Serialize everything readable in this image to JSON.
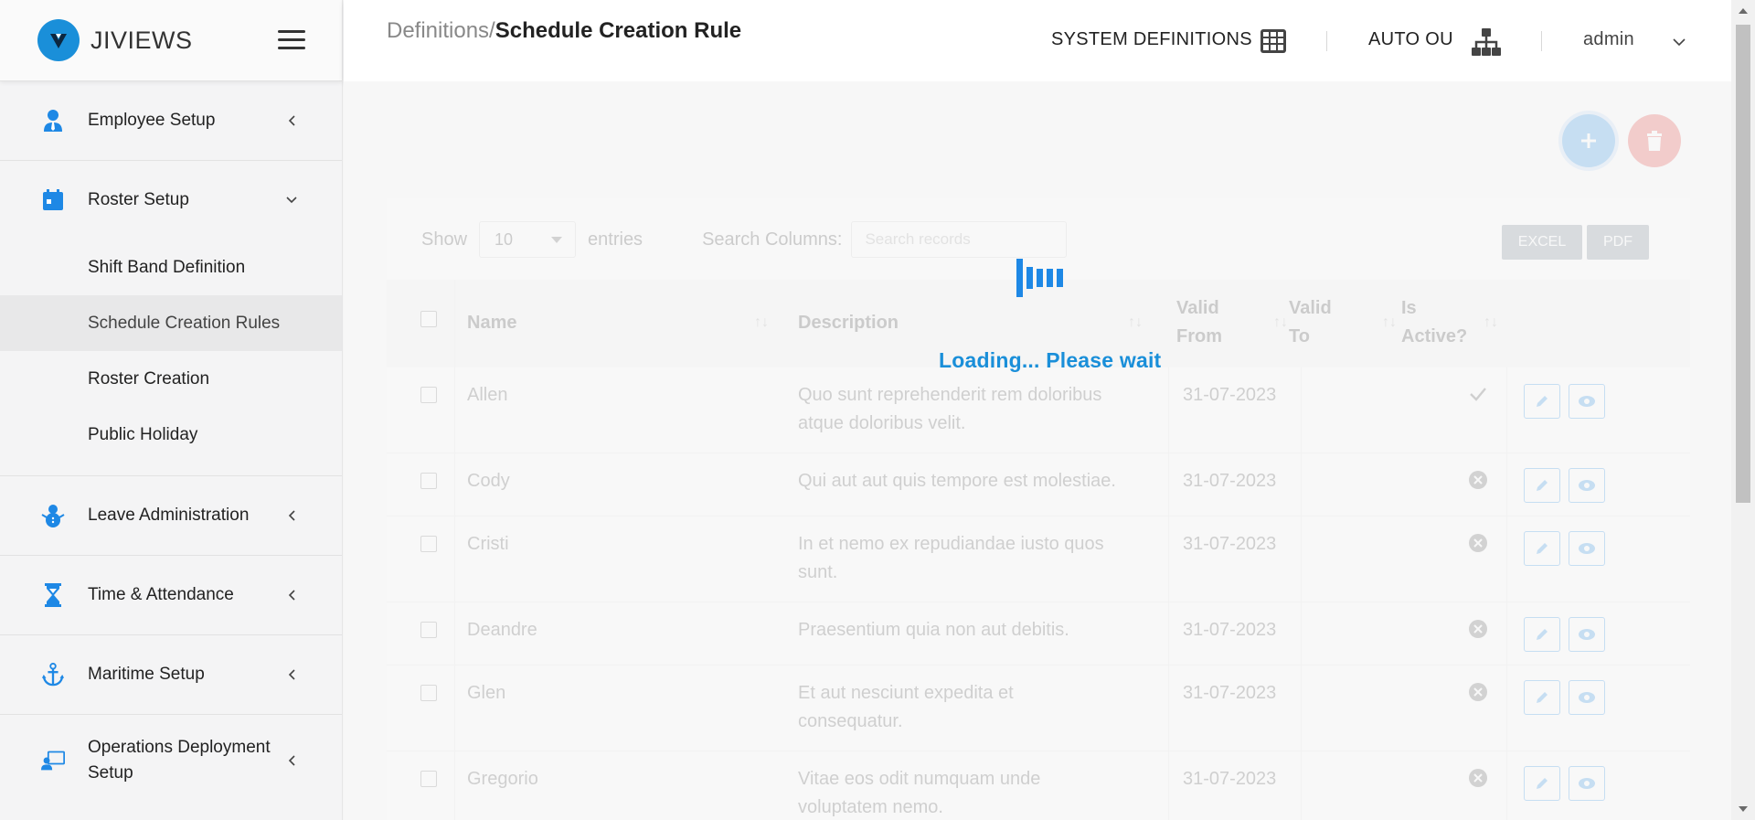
{
  "brand": {
    "name": "JIVIEWS"
  },
  "sidebar": {
    "items": [
      {
        "label": "Employee Setup",
        "icon": "user-tie-icon"
      },
      {
        "label": "Roster Setup",
        "icon": "calendar-icon",
        "expanded": true,
        "children": [
          {
            "label": "Shift Band Definition"
          },
          {
            "label": "Schedule Creation Rules",
            "active": true
          },
          {
            "label": "Roster Creation"
          },
          {
            "label": "Public Holiday"
          }
        ]
      },
      {
        "label": "Leave Administration",
        "icon": "snowman-icon"
      },
      {
        "label": "Time & Attendance",
        "icon": "hourglass-icon"
      },
      {
        "label": "Maritime Setup",
        "icon": "anchor-icon"
      },
      {
        "label": "Operations Deployment Setup",
        "icon": "deployment-icon"
      }
    ]
  },
  "header": {
    "breadcrumb_parent": "Definitions/",
    "breadcrumb_current": "Schedule Creation Rule",
    "system_definitions": "SYSTEM DEFINITIONS",
    "auto_ou": "AUTO OU",
    "user": "admin"
  },
  "colors": {
    "accent": "#1e88e5",
    "brand": "#1a8fd9",
    "danger": "#e53935"
  },
  "table": {
    "show_label": "Show",
    "entries_value": "10",
    "entries_label": "entries",
    "search_label": "Search Columns:",
    "search_placeholder": "Search records",
    "excel_label": "EXCEL",
    "pdf_label": "PDF",
    "columns": [
      "Name",
      "Description",
      "Valid From",
      "Valid To",
      "Is Active?"
    ],
    "rows": [
      {
        "name": "Allen",
        "description": "Quo sunt reprehenderit rem doloribus atque doloribus velit.",
        "valid_from": "31-07-2023",
        "valid_to": "",
        "active": true
      },
      {
        "name": "Cody",
        "description": "Qui aut aut quis tempore est molestiae.",
        "valid_from": "31-07-2023",
        "valid_to": "",
        "active": false
      },
      {
        "name": "Cristi",
        "description": "In et nemo ex repudiandae iusto quos sunt.",
        "valid_from": "31-07-2023",
        "valid_to": "",
        "active": false
      },
      {
        "name": "Deandre",
        "description": "Praesentium quia non aut debitis.",
        "valid_from": "31-07-2023",
        "valid_to": "",
        "active": false
      },
      {
        "name": "Glen",
        "description": "Et aut nesciunt expedita et consequatur.",
        "valid_from": "31-07-2023",
        "valid_to": "",
        "active": false
      },
      {
        "name": "Gregorio",
        "description": "Vitae eos odit numquam unde voluptatem nemo.",
        "valid_from": "31-07-2023",
        "valid_to": "",
        "active": false
      }
    ]
  },
  "loading": {
    "text": "Loading... Please wait"
  }
}
